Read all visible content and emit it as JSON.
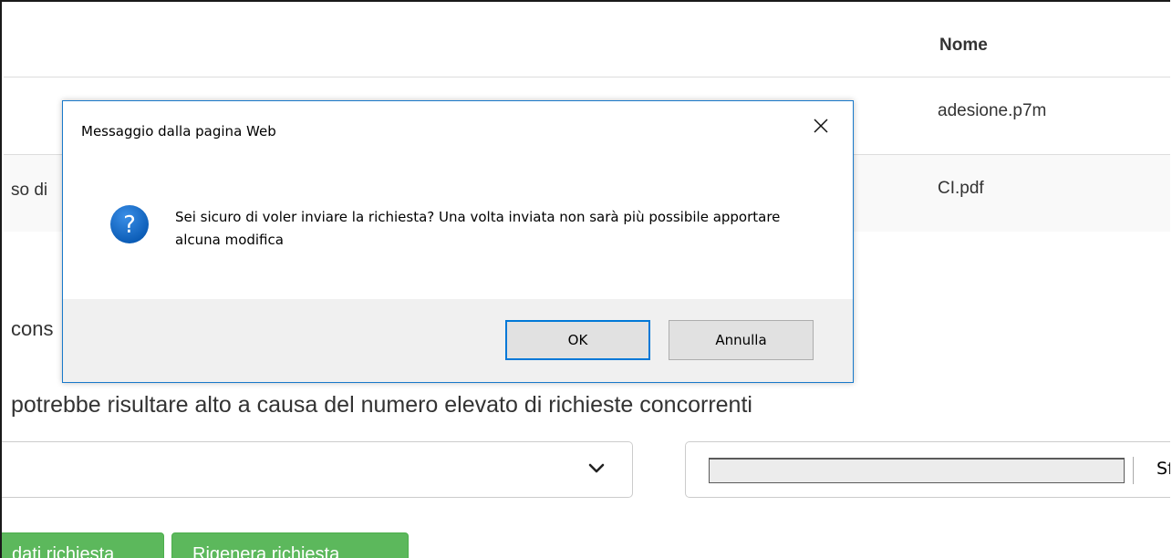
{
  "table": {
    "header_nome": "Nome",
    "rows": [
      {
        "left_text": "",
        "nome": "adesione.p7m"
      },
      {
        "left_text": "so di",
        "nome": "CI.pdf"
      }
    ]
  },
  "page": {
    "partial_cons": "cons",
    "notice": "potrebbe risultare alto a causa del numero elevato di richieste concorrenti",
    "file_button_label": "Sf",
    "buttons": {
      "dati": "dati richiesta",
      "rigenera": "Rigenera richiesta"
    }
  },
  "dialog": {
    "title": "Messaggio dalla pagina Web",
    "message": "Sei sicuro di voler inviare la richiesta? Una volta inviata non sarà più possibile apportare alcuna modifica",
    "ok_label": "OK",
    "cancel_label": "Annulla",
    "icon": "question-icon",
    "accent_color": "#0078d7"
  }
}
